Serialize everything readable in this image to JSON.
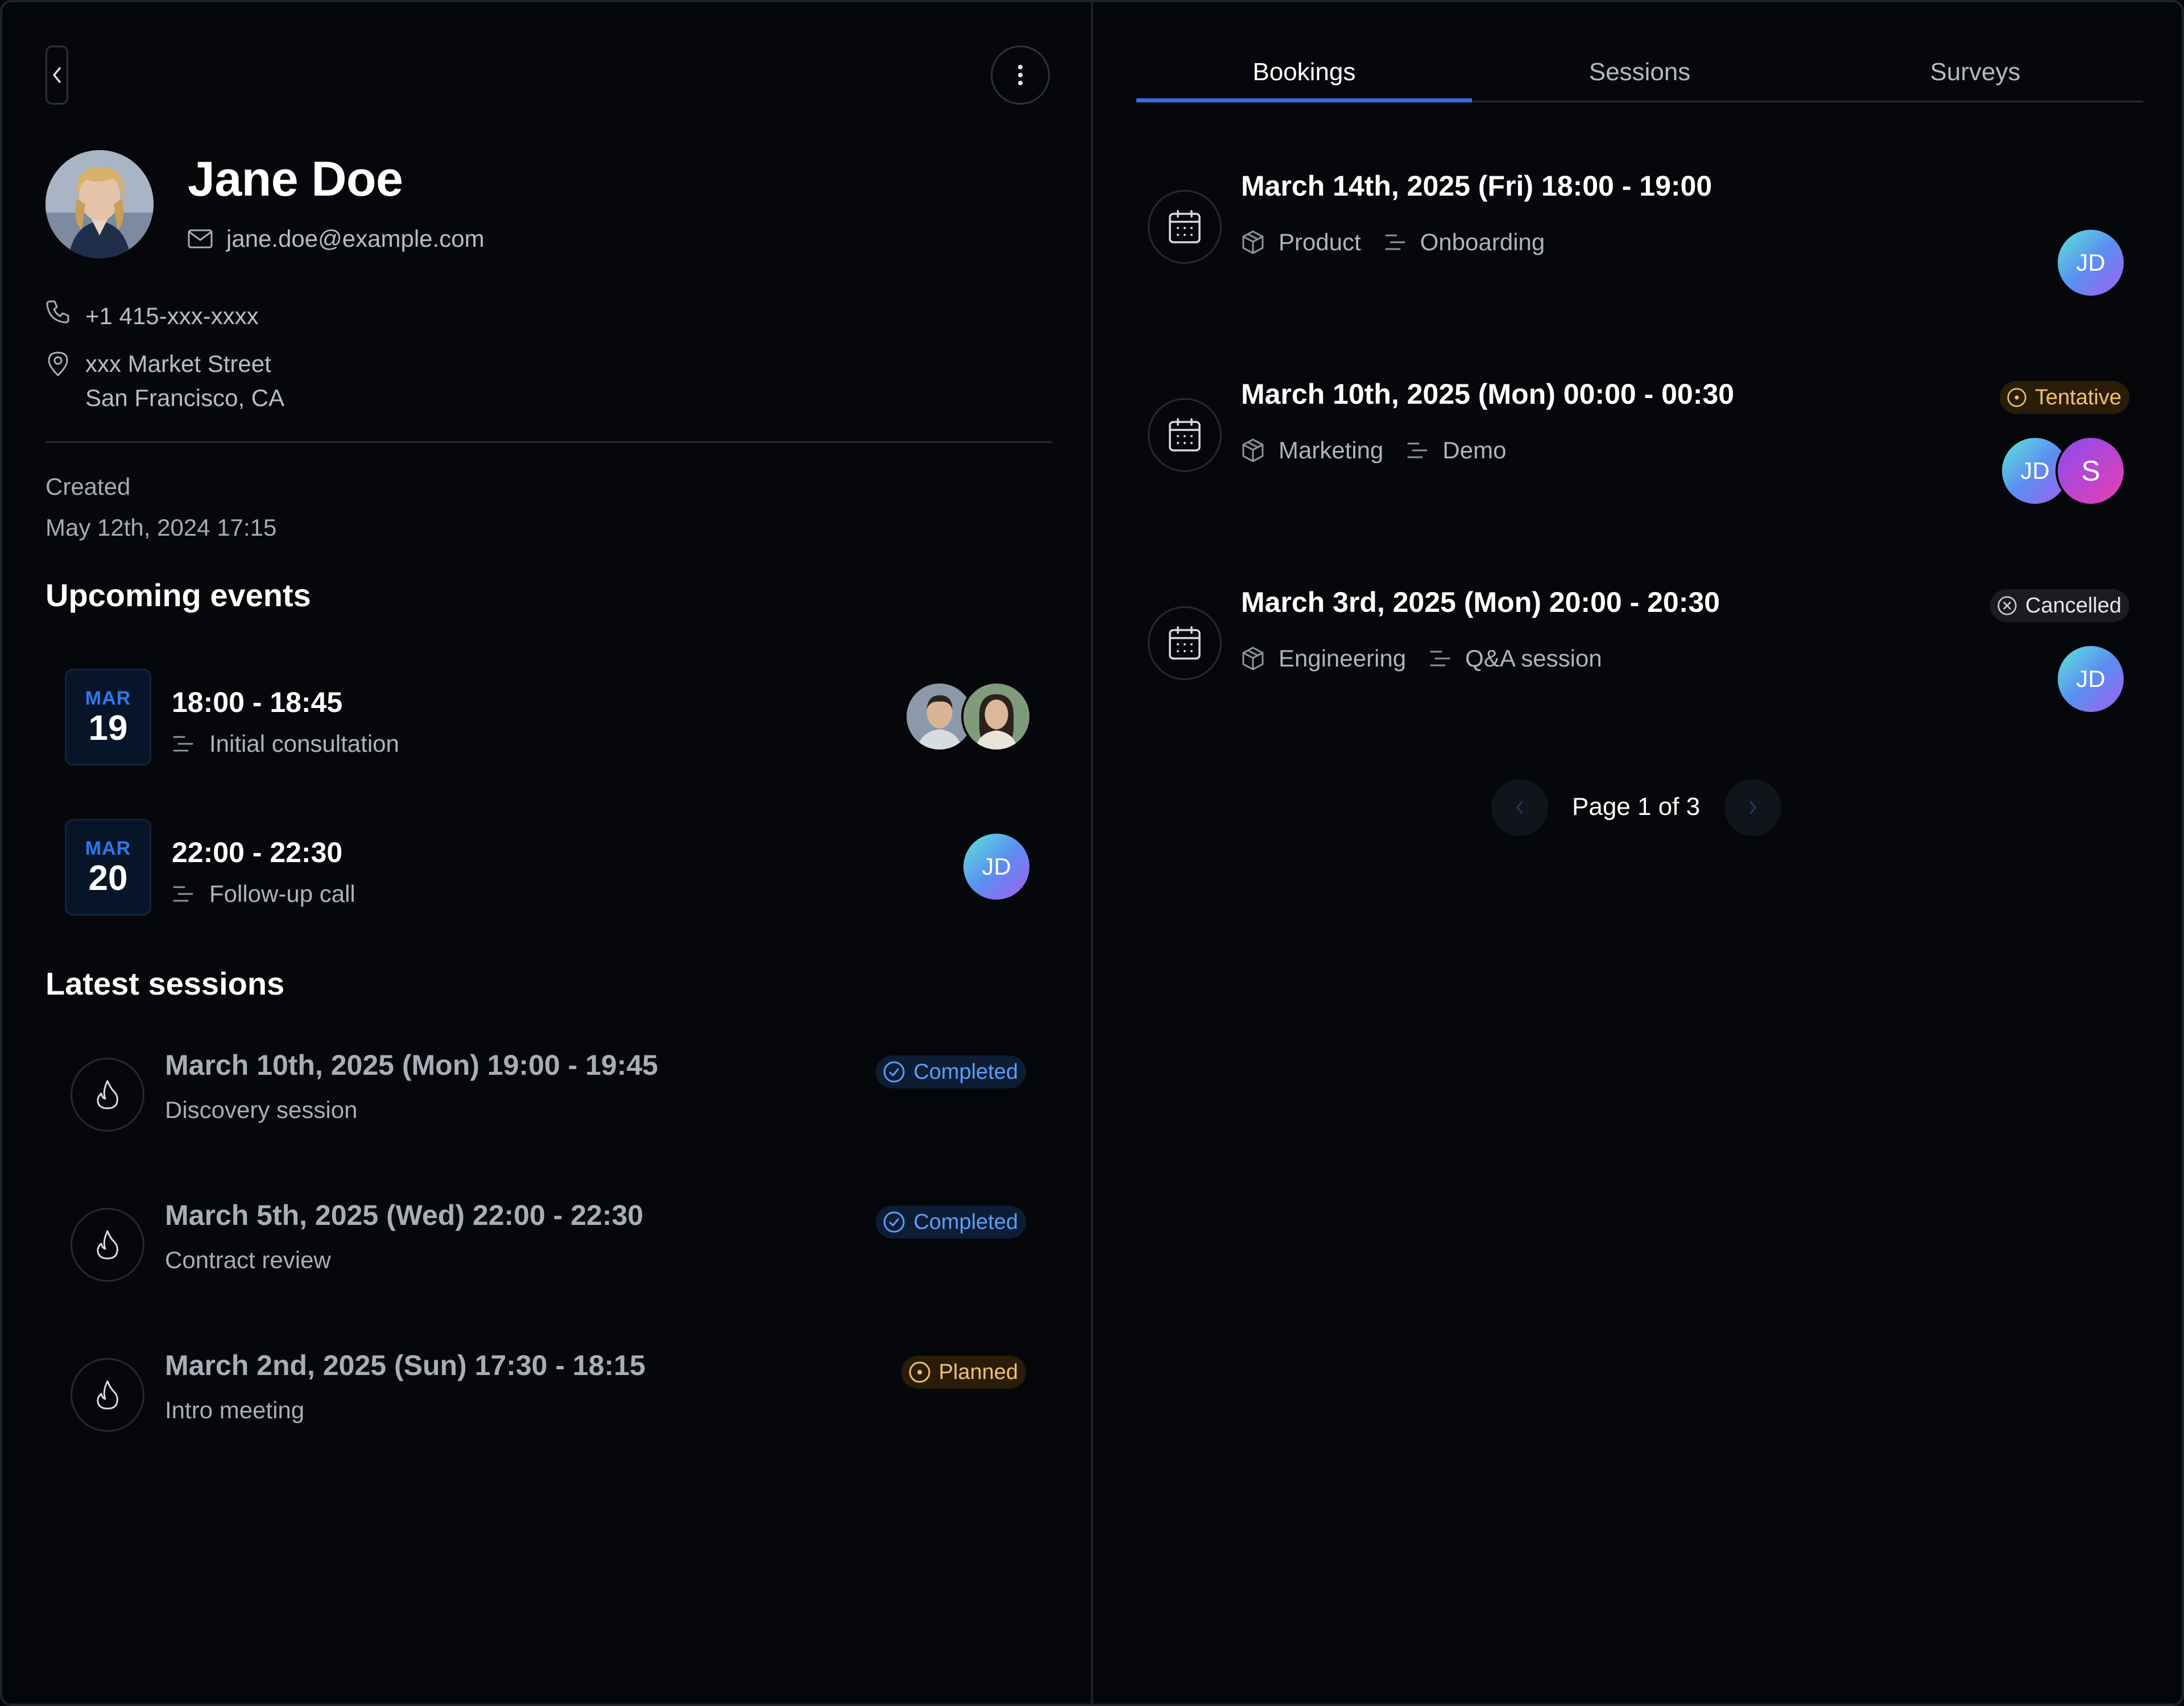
{
  "profile": {
    "name": "Jane Doe",
    "email": "jane.doe@example.com",
    "phone": "+1 415-xxx-xxxx",
    "address_line1": "xxx Market Street",
    "address_line2": "San Francisco, CA",
    "created_label": "Created",
    "created_value": "May 12th, 2024 17:15"
  },
  "upcoming": {
    "title": "Upcoming events",
    "items": [
      {
        "month": "MAR",
        "day": "19",
        "time": "18:00 - 18:45",
        "label": "Initial consultation"
      },
      {
        "month": "MAR",
        "day": "20",
        "time": "22:00 - 22:30",
        "label": "Follow-up call",
        "avatar": "JD"
      }
    ]
  },
  "sessions": {
    "title": "Latest sessions",
    "items": [
      {
        "title": "March 10th, 2025 (Mon) 19:00 - 19:45",
        "desc": "Discovery session",
        "status": "Completed"
      },
      {
        "title": "March 5th, 2025 (Wed) 22:00 - 22:30",
        "desc": "Contract review",
        "status": "Completed"
      },
      {
        "title": "March 2nd, 2025 (Sun) 17:30 - 18:15",
        "desc": "Intro meeting",
        "status": "Planned"
      }
    ]
  },
  "tabs": [
    "Bookings",
    "Sessions",
    "Surveys"
  ],
  "bookings": [
    {
      "title": "March 14th, 2025 (Fri) 18:00 - 19:00",
      "team": "Product",
      "type": "Onboarding",
      "avatars": [
        "JD"
      ]
    },
    {
      "title": "March 10th, 2025 (Mon) 00:00 - 00:30",
      "team": "Marketing",
      "type": "Demo",
      "status": "Tentative",
      "avatars": [
        "JD",
        "S"
      ]
    },
    {
      "title": "March 3rd, 2025 (Mon) 20:00 - 20:30",
      "team": "Engineering",
      "type": "Q&A session",
      "status": "Cancelled",
      "avatars": [
        "JD"
      ]
    }
  ],
  "pagination": {
    "label": "Page 1 of 3"
  },
  "colors": {
    "accent": "#2e72e5",
    "completed": "#5b9ef8",
    "planned": "#f0c16a",
    "background": "#05070b"
  }
}
